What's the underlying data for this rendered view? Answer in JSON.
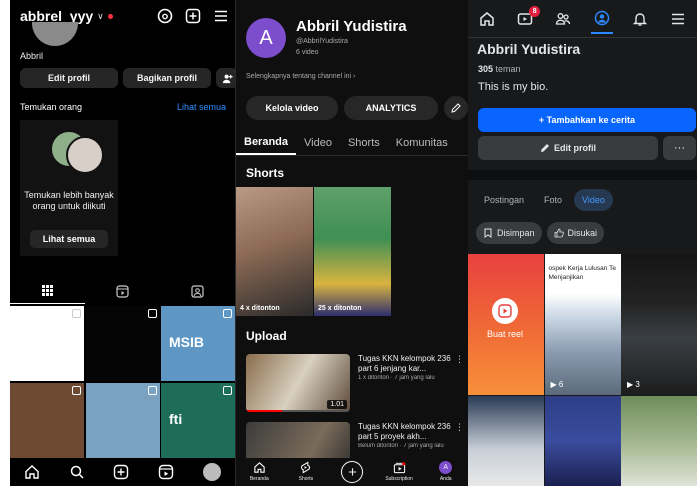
{
  "instagram": {
    "username": "abbrel_yyy",
    "display_name": "Abbril",
    "edit_profile": "Edit profil",
    "share_profile": "Bagikan profil",
    "discover_title": "Temukan orang",
    "see_all_link": "Lihat semua",
    "card_text": "Temukan lebih banyak orang untuk diikuti",
    "card_button": "Lihat semua",
    "grid_tiles": [
      {
        "color": "#ffffff",
        "reel": true
      },
      {
        "color": "#050505",
        "reel": true
      },
      {
        "color": "#5f97c4",
        "reel": true,
        "caption": "MSIB"
      },
      {
        "color": "#6e4a32",
        "reel": true
      },
      {
        "color": "#7aa2c0",
        "reel": true
      },
      {
        "color": "#1d6d5a",
        "reel": true,
        "caption": "fti"
      }
    ]
  },
  "youtube": {
    "avatar_letter": "A",
    "channel_name": "Abbril Yudistira",
    "handle": "@AbbrilYudistira",
    "video_count": "6 video",
    "more_about": "Selengkapnya tentang channel ini",
    "manage_videos": "Kelola video",
    "analytics": "ANALYTICS",
    "tabs": [
      "Beranda",
      "Video",
      "Shorts",
      "Komunitas"
    ],
    "shorts_title": "Shorts",
    "shorts": [
      {
        "views": "4 x ditonton",
        "color": "#8c6a55"
      },
      {
        "views": "25 x ditonton",
        "color": "#3f8f55"
      }
    ],
    "upload_title": "Upload",
    "videos": [
      {
        "title": "Tugas KKN kelompok 236 part 6 jenjang kar...",
        "meta": "1 x ditonton · 7 jam yang lalu",
        "duration": "1.01",
        "progress": 0.35
      },
      {
        "title": "Tugas KKN kelompok 236 part 5 proyek akh...",
        "meta": "Belum ditonton · 7 jam yang lalu",
        "duration": "",
        "progress": 0
      }
    ],
    "nav": [
      "Beranda",
      "Shorts",
      "",
      "Subscription",
      "Anda"
    ]
  },
  "facebook": {
    "notification_badge": "8",
    "name": "Abbril Yudistira",
    "friend_count": "305",
    "friend_label": "teman",
    "bio": "This is my bio.",
    "add_story": "+ Tambahkan ke cerita",
    "edit_profile": "Edit profil",
    "more": "···",
    "tabs": [
      "Postingan",
      "Foto",
      "Video"
    ],
    "filters": [
      "Disimpan",
      "Disukai"
    ],
    "create_reel": "Buat reel",
    "reel_tile_text": "ospek Kerja Lulusan Te Menjanjikan",
    "plays": [
      "6",
      "3"
    ]
  }
}
